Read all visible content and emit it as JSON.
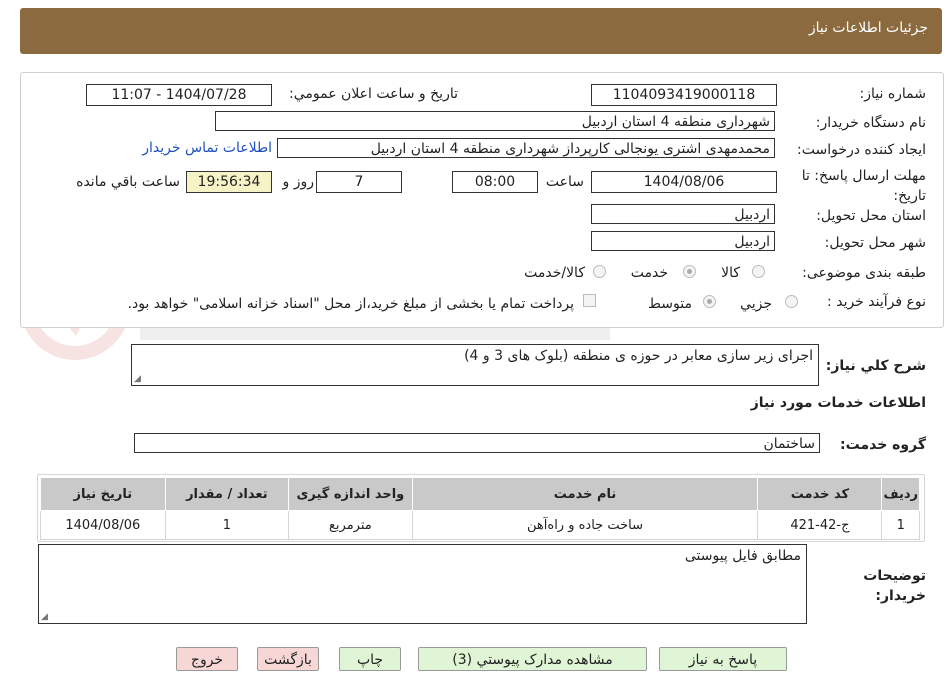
{
  "header": {
    "title": "جزئیات اطلاعات نیاز"
  },
  "form": {
    "need_number_label": "شماره نیاز:",
    "need_number": "1104093419000118",
    "announce_label": "تاريخ و ساعت اعلان عمومي:",
    "announce_value": "1404/07/28 - 11:07",
    "buyer_org_label": "نام دستگاه خريدار:",
    "buyer_org": "شهرداری منطقه 4 استان اردبیل",
    "requester_label": "ايجاد کننده درخواست:",
    "requester": "محمدمهدی اشتری یونجالی کارپرداز شهرداری منطقه 4 استان اردبیل",
    "contact_link": "اطلاعات تماس خريدار",
    "deadline_label": "مهلت ارسال پاسخ: تا تاريخ:",
    "deadline_date": "1404/08/06",
    "time_label": "ساعت",
    "deadline_time": "08:00",
    "days_value": "7",
    "days_label": "روز و",
    "remaining_time": "19:56:34",
    "remaining_label": "ساعت باقي مانده",
    "province_label": "استان محل تحويل:",
    "province": "اردبیل",
    "city_label": "شهر محل تحويل:",
    "city": "اردبیل",
    "category_label": "طبقه بندی موضوعی:",
    "category_options": [
      "کالا",
      "خدمت",
      "کالا/خدمت"
    ],
    "category_selected": "خدمت",
    "process_label": "نوع فرآيند خريد :",
    "process_options": [
      "جزيي",
      "متوسط"
    ],
    "process_selected": "متوسط",
    "payment_note": "پرداخت تمام یا بخشی از مبلغ خرید،از محل \"اسناد خزانه اسلامی\" خواهد بود."
  },
  "description": {
    "label": "شرح کلي نياز:",
    "value": "اجرای زیر سازی معابر در حوزه ی منطقه (بلوک های 3 و 4)"
  },
  "services": {
    "section_title": "اطلاعات خدمات مورد نياز",
    "group_label": "گروه خدمت:",
    "group_value": "ساختمان",
    "columns": [
      "رديف",
      "کد خدمت",
      "نام خدمت",
      "واحد اندازه گيری",
      "تعداد / مقدار",
      "تاريخ نياز"
    ],
    "rows": [
      [
        "1",
        "ج-42-421",
        "ساخت جاده و راه‌آهن",
        "مترمربع",
        "1",
        "1404/08/06"
      ]
    ]
  },
  "buyer_notes": {
    "label": "توضيحات خريدار:",
    "value": "مطابق فایل پیوستی"
  },
  "buttons": {
    "reply": "پاسخ به نياز",
    "attachments": "مشاهده مدارک پيوستي (3)",
    "print": "چاپ",
    "back": "بازگشت",
    "exit": "خروج"
  },
  "colors": {
    "header_bg": "#8c6a3f",
    "link": "#1f4fbf",
    "remaining_bg": "#f6f4c6",
    "table_header_bg": "#c9c9c9",
    "btn_green": "#dff5d6",
    "btn_pink": "#f7d6d6"
  }
}
